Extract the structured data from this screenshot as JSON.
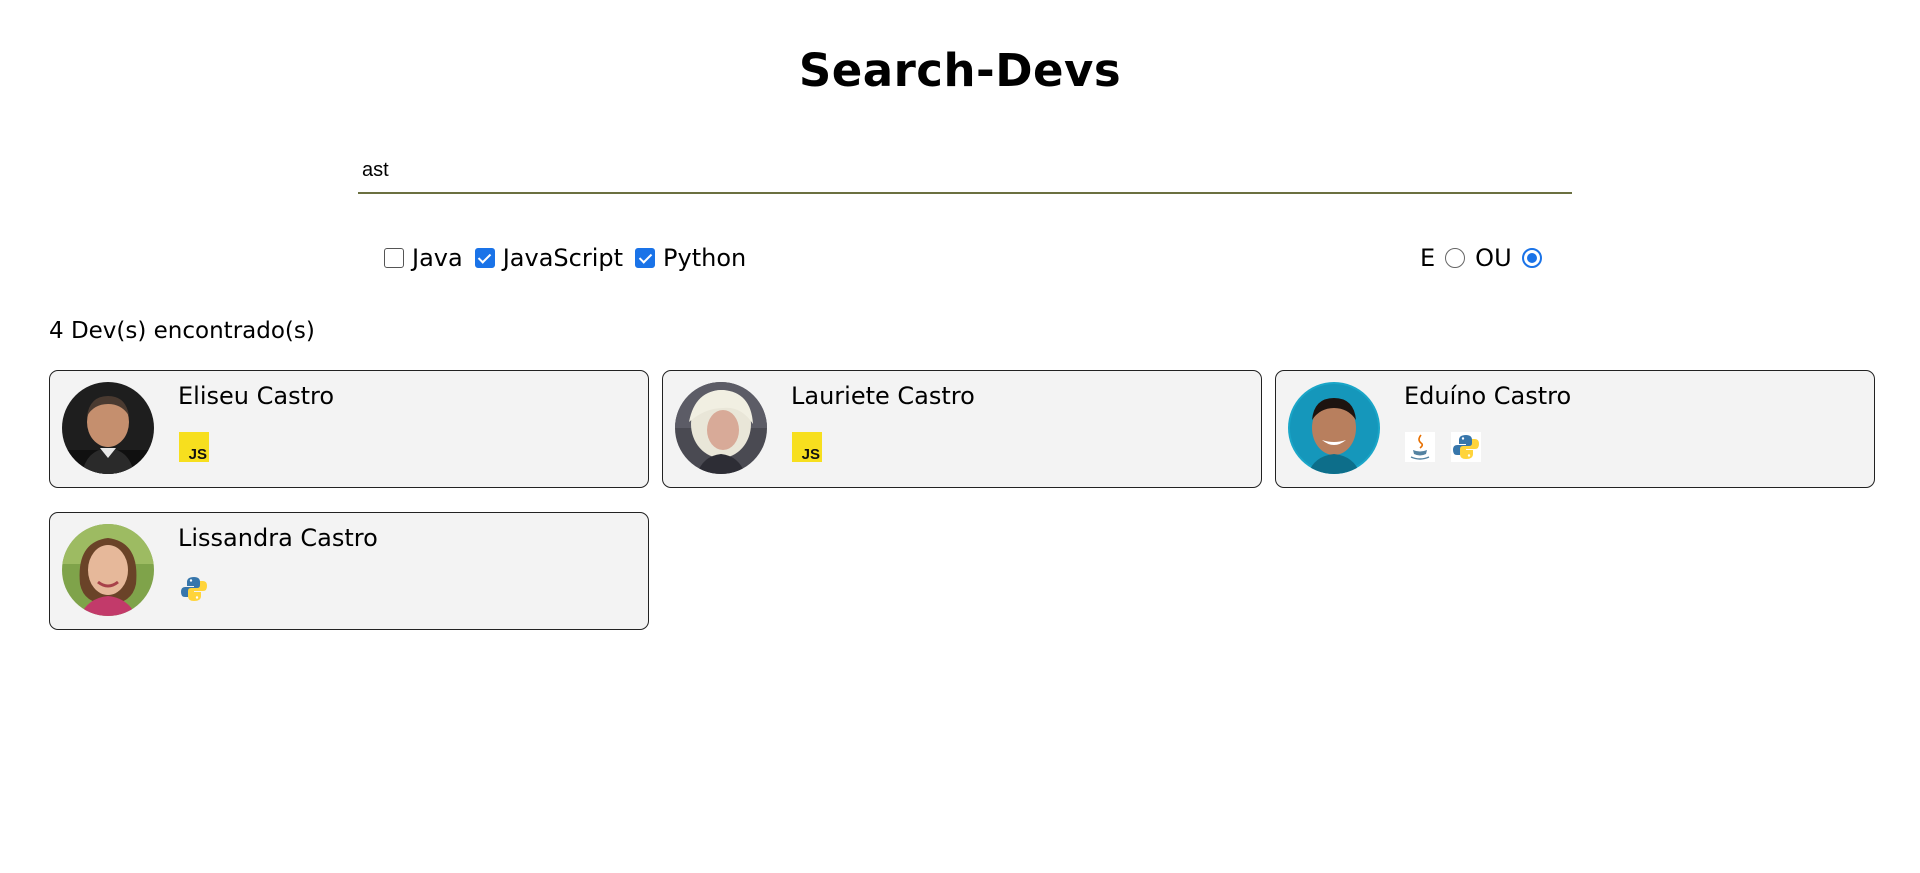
{
  "app": {
    "title": "Search-Devs"
  },
  "search": {
    "value": "ast",
    "placeholder": ""
  },
  "filters": [
    {
      "label": "Java",
      "checked": false
    },
    {
      "label": "JavaScript",
      "checked": true
    },
    {
      "label": "Python",
      "checked": true
    }
  ],
  "operator": {
    "and_label": "E",
    "and_checked": false,
    "or_label": "OU",
    "or_checked": true
  },
  "results": {
    "count_text": "4 Dev(s) encontrado(s)",
    "devs": [
      {
        "name": "Eliseu Castro",
        "technologies": [
          "javascript-icon"
        ]
      },
      {
        "name": "Lauriete Castro",
        "technologies": [
          "javascript-icon"
        ]
      },
      {
        "name": "Eduíno Castro",
        "technologies": [
          "java-icon",
          "python-icon"
        ]
      },
      {
        "name": "Lissandra Castro",
        "technologies": [
          "python-icon"
        ]
      }
    ]
  },
  "colors": {
    "accent": "#1a73e8",
    "card_background": "#f3f3f3",
    "search_underline": "#6b7040",
    "javascript_badge": "#f7df1e"
  }
}
